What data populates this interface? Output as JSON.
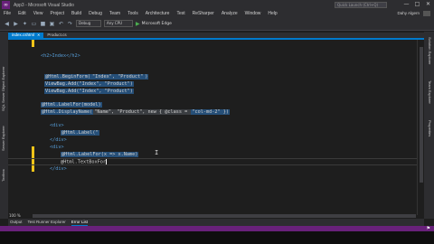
{
  "window": {
    "title": "App3 - Microsoft Visual Studio",
    "quick_launch_placeholder": "Quick Launch (Ctrl+Q)",
    "user_name": "Dahy Algern",
    "controls": [
      "—",
      "□",
      "✕"
    ]
  },
  "menu": [
    "File",
    "Edit",
    "View",
    "Project",
    "Build",
    "Debug",
    "Team",
    "Tools",
    "Architecture",
    "Test",
    "ReSharper",
    "Analyze",
    "Window",
    "Help"
  ],
  "toolbar": {
    "config": "Debug",
    "platform": "Any CPU",
    "run_label": "Microsoft Edge",
    "icons": [
      "back-icon",
      "forward-icon",
      "new-project-icon",
      "open-icon",
      "save-icon",
      "save-all-icon",
      "undo-icon",
      "redo-icon"
    ]
  },
  "left_tabs": [
    "SQL Server Object Explorer",
    "Server Explorer",
    "Toolbox"
  ],
  "right_tabs": [
    "Solution Explorer",
    "Team Explorer",
    "Properties"
  ],
  "doc_tabs": [
    {
      "label": "index.cshtml",
      "active": true
    },
    {
      "label": "Product.cs",
      "active": false
    }
  ],
  "editor": {
    "zoom": "100 %",
    "lines": {
      "l1": "<h2>Index</h2>",
      "l2_a": "@Html.BeginForm(",
      "l2_b": "\"Index\", \"Product\"",
      "l2_c": ")",
      "l3": "ViewBag.Add(\"Index\", \"Product\")",
      "l4": "ViewBag.Add(\"Index\", \"Product\")",
      "l5": "@Html.LabelFor(model)",
      "l6_a": "@Html.DisplayName(",
      "l6_b": "\"Name\", \"Product\", new { @class = ",
      "l6_c": "\"col-md-2\" })",
      "l7": "<div>",
      "l8": "@Html.Label(\"",
      "l9": "</div>",
      "l10": "<div>",
      "l11": "@Html.LabelFor(x => x.Name)",
      "l12_a": "@Html.TextBoxFor",
      "l13": "</div>"
    }
  },
  "bottom_tabs": [
    {
      "label": "Output",
      "active": false
    },
    {
      "label": "Test Runner Explorer",
      "active": false
    },
    {
      "label": "Error List",
      "active": true
    }
  ]
}
